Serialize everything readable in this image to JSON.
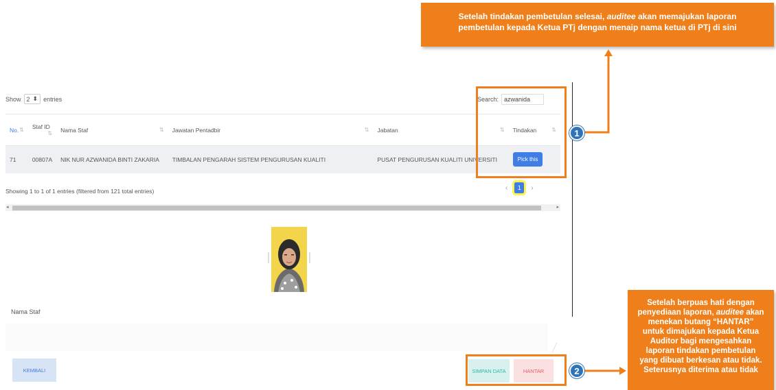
{
  "callouts": {
    "top": {
      "line1_pre": "Setelah tindakan pembetulan selesai, ",
      "line1_em": "auditee",
      "line1_post": " akan memajukan laporan",
      "line2": "pembetulan kepada Ketua PTj dengan menaip nama ketua di PTj di sini"
    },
    "bottom": {
      "l1": "Setelah berpuas hati dengan",
      "l2_pre": "penyediaan laporan, ",
      "l2_em": "auditee",
      "l2_post": " akan",
      "l3": "menekan butang “HANTAR”",
      "l4": "untuk dimajukan kepada Ketua",
      "l5": "Auditor bagi mengesahkan",
      "l6": "laporan tindakan pembetulan",
      "l7": "yang dibuat berkesan atau tidak.",
      "l8": "Seterusnya diterima atau tidak"
    }
  },
  "badges": {
    "one": "1",
    "two": "2"
  },
  "length_control": {
    "show": "Show",
    "value": "2",
    "entries": "entries"
  },
  "search": {
    "label": "Search:",
    "value": "azwanida"
  },
  "table": {
    "headers": [
      "No.",
      "Staf ID",
      "Nama Staf",
      "Jawatan Pentadbir",
      "Jabatan",
      "Tindakan"
    ],
    "rows": [
      {
        "no": "71",
        "staf_id": "00807A",
        "nama": "NIK NUR AZWANIDA BINTI ZAKARIA",
        "jawatan": "TIMBALAN PENGARAH SISTEM PENGURUSAN KUALITI",
        "jabatan": "PUSAT PENGURUSAN KUALITI UNIVERSITI",
        "action": "Pick this"
      }
    ]
  },
  "info": "Showing 1 to 1 of 1 entries (filtered from 121 total entries)",
  "pagination": {
    "prev": "‹",
    "current": "1",
    "next": "›"
  },
  "form": {
    "nama_label": "Nama Staf"
  },
  "buttons": {
    "kembali": "KEMBALI",
    "simpan": "SIMPAN DATA",
    "hantar": "HANTAR"
  },
  "colors": {
    "accent_orange": "#ef7f1a",
    "primary_blue": "#3e7ee6",
    "badge_blue": "#2f73b8",
    "highlight_yellow": "#fff24d"
  }
}
